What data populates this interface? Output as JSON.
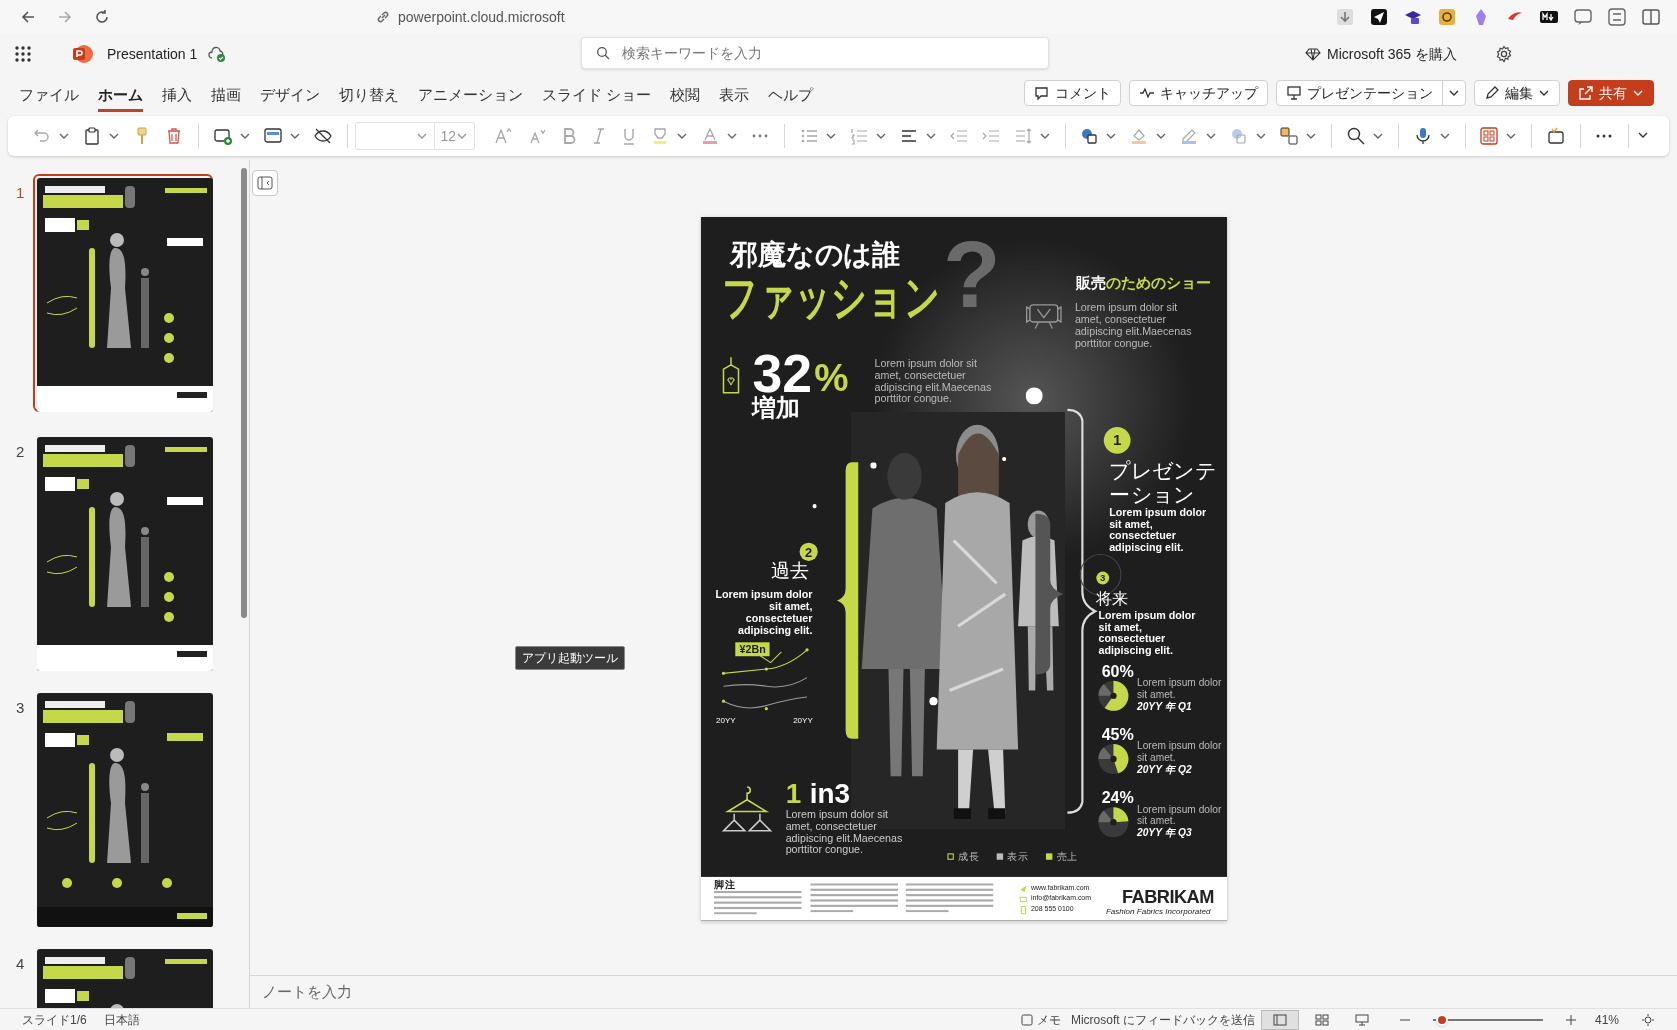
{
  "browser": {
    "url": "powerpoint.cloud.microsoft"
  },
  "app": {
    "title": "Presentation 1",
    "search_placeholder": "検索キーワードを入力",
    "buy": "Microsoft 365 を購入"
  },
  "ribbon_tabs": [
    {
      "label": "ファイル",
      "selected": false
    },
    {
      "label": "ホーム",
      "selected": true
    },
    {
      "label": "挿入",
      "selected": false
    },
    {
      "label": "描画",
      "selected": false
    },
    {
      "label": "デザイン",
      "selected": false
    },
    {
      "label": "切り替え",
      "selected": false
    },
    {
      "label": "アニメーション",
      "selected": false
    },
    {
      "label": "スライド ショー",
      "selected": false
    },
    {
      "label": "校閲",
      "selected": false
    },
    {
      "label": "表示",
      "selected": false
    },
    {
      "label": "ヘルプ",
      "selected": false
    }
  ],
  "actions": [
    {
      "label": "コメント",
      "kind": "comment"
    },
    {
      "label": "キャッチアップ",
      "kind": "catchup"
    },
    {
      "label": "プレゼンテーション",
      "kind": "present"
    },
    {
      "label": "編集",
      "kind": "edit"
    },
    {
      "label": "共有",
      "kind": "share"
    }
  ],
  "toolbar": {
    "font_size": "12"
  },
  "slides": [
    {
      "number": "1",
      "selected": true
    },
    {
      "number": "2",
      "selected": false
    },
    {
      "number": "3",
      "selected": false
    },
    {
      "number": "4",
      "selected": false
    }
  ],
  "tooltip": "アプリ起動ツール",
  "slide": {
    "title_line1": "邪魔なのは誰",
    "title_line2": "ファッション",
    "question_mark": "?",
    "show": {
      "title_plain": "販売",
      "title_accent": "のためのショー",
      "text": "Lorem ipsum dolor sit amet, consectetuer adipiscing elit.Maecenas porttitor congue."
    },
    "increase": {
      "number": "32",
      "unit": "%",
      "label": "増加",
      "text": "Lorem ipsum dolor sit amet, consectetuer adipiscing elit.Maecenas porttitor congue."
    },
    "past": {
      "badge": "2",
      "title": "過去",
      "text": "Lorem ipsum dolor sit amet, consectetuer adipiscing elit.",
      "value": "¥2Bn",
      "axis_start": "20YY",
      "axis_end": "20YY"
    },
    "ratio": {
      "number": "1",
      "label": "in3",
      "text": "Lorem ipsum dolor sit amet, consectetuer adipiscing elit.Maecenas porttitor congue."
    },
    "presentation": {
      "badge": "1",
      "title": "プレゼンテーション",
      "text": "Lorem ipsum dolor sit amet, consectetuer adipiscing elit."
    },
    "future": {
      "badge": "3",
      "title": "将来",
      "text": "Lorem ipsum dolor sit amet, consectetuer adipiscing elit."
    },
    "stats": [
      {
        "value": "60%",
        "text": "Lorem ipsum dolor sit amet.",
        "period": "20YY 年 Q1"
      },
      {
        "value": "45%",
        "text": "Lorem ipsum dolor sit amet.",
        "period": "20YY 年 Q2"
      },
      {
        "value": "24%",
        "text": "Lorem ipsum dolor sit amet.",
        "period": "20YY 年 Q3"
      }
    ],
    "legend": [
      {
        "label": "成長",
        "kind": "outline"
      },
      {
        "label": "表示",
        "kind": "gray"
      },
      {
        "label": "売上",
        "kind": "solid"
      }
    ],
    "footnote_heading": "脚注",
    "contacts": [
      {
        "kind": "web",
        "text": "www.fabrikam.com"
      },
      {
        "kind": "mail",
        "text": "info@fabrikam.com"
      },
      {
        "kind": "phone",
        "text": "208 555 0100"
      }
    ],
    "brand": {
      "name": "FABRIKAM",
      "tagline": "Fashion Fabrics Incorporated"
    }
  },
  "notes_placeholder": "ノートを入力",
  "status_bar": {
    "slide_info": "スライド1/6",
    "language": "日本語",
    "notes": "メモ",
    "feedback": "Microsoft にフィードバックを送信",
    "zoom": "41%",
    "zoom_slider": {
      "level": 0.03
    }
  }
}
